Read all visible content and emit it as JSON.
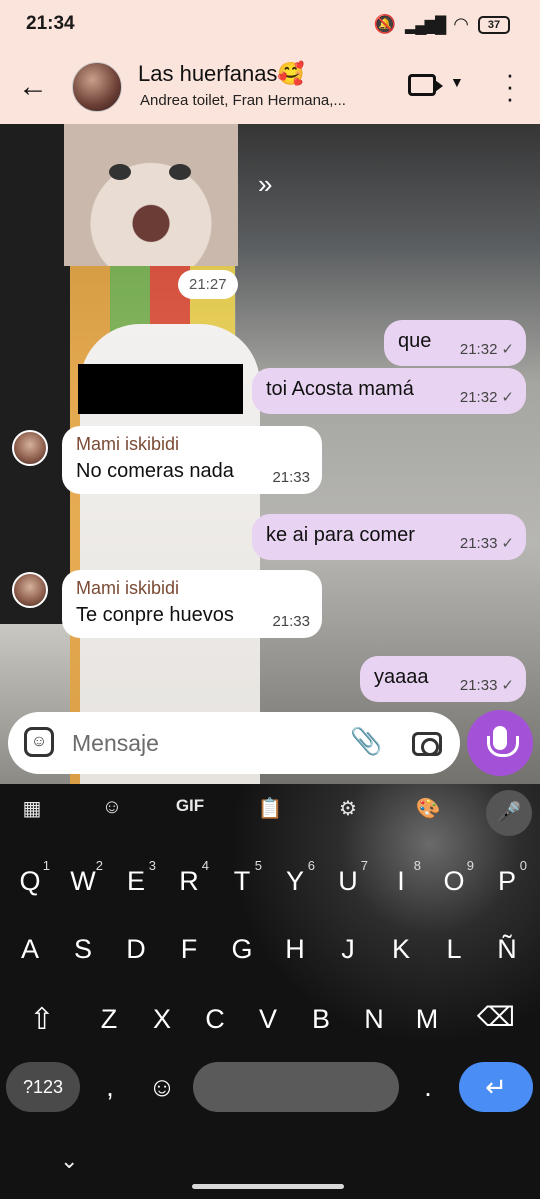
{
  "status_bar": {
    "time": "21:34",
    "battery": "37"
  },
  "header": {
    "title": "Las huerfanas🥰",
    "subtitle": "Andrea toilet, Fran Hermana,..."
  },
  "chat": {
    "sticker_time": "21:27",
    "messages": [
      {
        "dir": "out",
        "text": "que",
        "time": "21:32"
      },
      {
        "dir": "out",
        "text": "toi Acosta mamá",
        "time": "21:32"
      },
      {
        "dir": "in",
        "sender": "Mami iskibidi",
        "text": "No comeras nada",
        "time": "21:33"
      },
      {
        "dir": "out",
        "text": "ke ai para comer",
        "time": "21:33"
      },
      {
        "dir": "in",
        "sender": "Mami iskibidi",
        "text": "Te conpre huevos",
        "time": "21:33"
      },
      {
        "dir": "out",
        "text": "yaaaa",
        "time": "21:33"
      }
    ]
  },
  "input": {
    "placeholder": "Mensaje"
  },
  "keyboard": {
    "toolbar": [
      "GIF"
    ],
    "row1": [
      "Q",
      "W",
      "E",
      "R",
      "T",
      "Y",
      "U",
      "I",
      "O",
      "P"
    ],
    "row1_hints": [
      "1",
      "2",
      "3",
      "4",
      "5",
      "6",
      "7",
      "8",
      "9",
      "0"
    ],
    "row2": [
      "A",
      "S",
      "D",
      "F",
      "G",
      "H",
      "J",
      "K",
      "L",
      "Ñ"
    ],
    "row3": [
      "Z",
      "X",
      "C",
      "V",
      "B",
      "N",
      "M"
    ],
    "sym_label": "?123",
    "comma": ",",
    "period": "."
  },
  "colors": {
    "header_bg": "#fbe4dc",
    "outgoing_bubble": "#e8d4f2",
    "mic_button": "#a352d8",
    "enter_key": "#4a8ef5"
  },
  "icons": [
    "back-arrow-icon",
    "video-call-icon",
    "more-vert-icon",
    "forward-icon",
    "sticker-icon",
    "attach-icon",
    "camera-icon",
    "mic-icon",
    "read-check-icon"
  ]
}
